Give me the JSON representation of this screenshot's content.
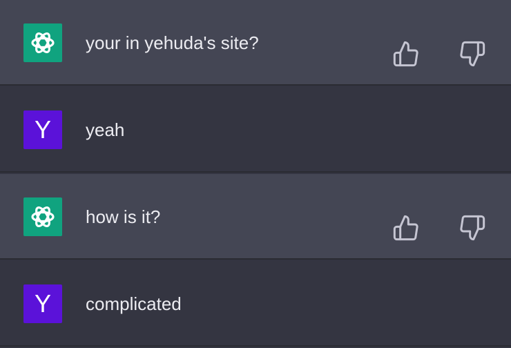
{
  "colors": {
    "assistant_bg": "#444654",
    "user_bg": "#343541",
    "bot_avatar": "#10a37f",
    "user_avatar": "#5b12d9",
    "text": "#ececf1",
    "icon": "#c5c5d2"
  },
  "messages": [
    {
      "role": "assistant",
      "avatar_icon": "openai-logo-icon",
      "text": "your in yehuda's site?"
    },
    {
      "role": "user",
      "avatar_letter": "Y",
      "text": "yeah"
    },
    {
      "role": "assistant",
      "avatar_icon": "openai-logo-icon",
      "text": "how is it?"
    },
    {
      "role": "user",
      "avatar_letter": "Y",
      "text": "complicated"
    }
  ],
  "feedback_icons": {
    "up": "thumbs-up-icon",
    "down": "thumbs-down-icon"
  }
}
